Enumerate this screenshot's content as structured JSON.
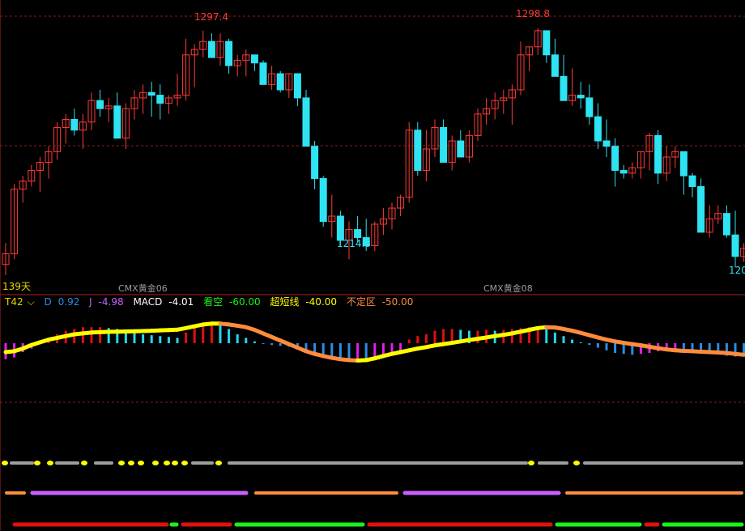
{
  "colors": {
    "background": "#000000",
    "up_candle": "#ff3a3a",
    "down_candle": "#2ee3f2",
    "grid": "#8a1e1e",
    "pane_divider": "#b02020",
    "contract_label": "#9a9a9a",
    "yellow": "#ffff00",
    "orange": "#ff8c3c",
    "red": "#e01010",
    "cyan": "#22d8ee",
    "blue": "#2a8ce8",
    "magenta": "#e020e8",
    "purple": "#c860ff",
    "green": "#19f219",
    "gray": "#9e9e9e",
    "white": "#ffffff",
    "dim": "#b0b0b0"
  },
  "price_labels": {
    "high_1": "1297.4",
    "high_2": "1298.8",
    "low_1": "1214.3",
    "edge_value": "120"
  },
  "bar_count_label": "139天",
  "contract_labels": [
    "CMX黄金06",
    "CMX黄金08"
  ],
  "indicator": {
    "name": "T42",
    "dropdown_glyph": "⌵",
    "d_label": "D",
    "d_value": "0.92",
    "j_label": "J",
    "j_value": "-4.98",
    "macd_label": "MACD",
    "macd_value": "-4.01",
    "bear_label": "看空",
    "bear_value": "-60.00",
    "short_label": "超短线",
    "short_value": "-40.00",
    "neutral_label": "不定区",
    "neutral_value": "-50.00"
  },
  "chart_data": {
    "type": "candlestick",
    "ohlc": [
      [
        1212,
        1220,
        1208,
        1216
      ],
      [
        1216,
        1242,
        1214,
        1240
      ],
      [
        1240,
        1245,
        1235,
        1243
      ],
      [
        1243,
        1249,
        1241,
        1247
      ],
      [
        1247,
        1252,
        1239,
        1250
      ],
      [
        1250,
        1256,
        1244,
        1254
      ],
      [
        1254,
        1265,
        1251,
        1263
      ],
      [
        1263,
        1268,
        1257,
        1266
      ],
      [
        1266,
        1270,
        1260,
        1262
      ],
      [
        1262,
        1268,
        1255,
        1265
      ],
      [
        1265,
        1276,
        1262,
        1273
      ],
      [
        1273,
        1277,
        1267,
        1270
      ],
      [
        1270,
        1274,
        1265,
        1271
      ],
      [
        1271,
        1276,
        1266,
        1259
      ],
      [
        1259,
        1272,
        1255,
        1270
      ],
      [
        1270,
        1277,
        1266,
        1274
      ],
      [
        1274,
        1279,
        1268,
        1276
      ],
      [
        1276,
        1280,
        1267,
        1275
      ],
      [
        1275,
        1279,
        1266,
        1272
      ],
      [
        1272,
        1275,
        1268,
        1274
      ],
      [
        1274,
        1283,
        1271,
        1275
      ],
      [
        1275,
        1296,
        1273,
        1290
      ],
      [
        1290,
        1294,
        1278,
        1292
      ],
      [
        1292,
        1299,
        1289,
        1295
      ],
      [
        1295,
        1298,
        1289,
        1289
      ],
      [
        1289,
        1298,
        1286,
        1295
      ],
      [
        1295,
        1296,
        1283,
        1286
      ],
      [
        1286,
        1290,
        1282,
        1288
      ],
      [
        1288,
        1292,
        1282,
        1290
      ],
      [
        1290,
        1290,
        1284,
        1287
      ],
      [
        1287,
        1288,
        1280,
        1279
      ],
      [
        1279,
        1286,
        1277,
        1283
      ],
      [
        1283,
        1284,
        1276,
        1277
      ],
      [
        1277,
        1283,
        1274,
        1283
      ],
      [
        1283,
        1283,
        1271,
        1274
      ],
      [
        1274,
        1277,
        1258,
        1256
      ],
      [
        1256,
        1258,
        1240,
        1244
      ],
      [
        1244,
        1245,
        1226,
        1228
      ],
      [
        1228,
        1238,
        1222,
        1230
      ],
      [
        1230,
        1232,
        1219,
        1221
      ],
      [
        1221,
        1228,
        1214,
        1225
      ],
      [
        1225,
        1230,
        1220,
        1222
      ],
      [
        1222,
        1229,
        1217,
        1219
      ],
      [
        1219,
        1228,
        1217,
        1227
      ],
      [
        1227,
        1233,
        1223,
        1229
      ],
      [
        1229,
        1235,
        1225,
        1233
      ],
      [
        1233,
        1238,
        1230,
        1237
      ],
      [
        1237,
        1265,
        1235,
        1262
      ],
      [
        1262,
        1265,
        1245,
        1247
      ],
      [
        1247,
        1262,
        1243,
        1255
      ],
      [
        1255,
        1266,
        1252,
        1263
      ],
      [
        1263,
        1266,
        1250,
        1250
      ],
      [
        1250,
        1260,
        1247,
        1258
      ],
      [
        1258,
        1262,
        1252,
        1252
      ],
      [
        1252,
        1262,
        1250,
        1260
      ],
      [
        1260,
        1270,
        1258,
        1268
      ],
      [
        1268,
        1274,
        1264,
        1270
      ],
      [
        1270,
        1276,
        1266,
        1273
      ],
      [
        1273,
        1277,
        1268,
        1274
      ],
      [
        1274,
        1279,
        1264,
        1277
      ],
      [
        1277,
        1295,
        1275,
        1290
      ],
      [
        1290,
        1293,
        1284,
        1293
      ],
      [
        1293,
        1300,
        1290,
        1299
      ],
      [
        1299,
        1299,
        1287,
        1290
      ],
      [
        1290,
        1296,
        1282,
        1282
      ],
      [
        1282,
        1290,
        1273,
        1273
      ],
      [
        1273,
        1285,
        1271,
        1275
      ],
      [
        1275,
        1280,
        1270,
        1274
      ],
      [
        1274,
        1279,
        1264,
        1267
      ],
      [
        1267,
        1272,
        1255,
        1258
      ],
      [
        1258,
        1266,
        1252,
        1256
      ],
      [
        1256,
        1259,
        1241,
        1247
      ],
      [
        1247,
        1249,
        1244,
        1246
      ],
      [
        1246,
        1250,
        1244,
        1248
      ],
      [
        1248,
        1254,
        1244,
        1254
      ],
      [
        1254,
        1261,
        1247,
        1260
      ],
      [
        1260,
        1262,
        1242,
        1246
      ],
      [
        1246,
        1256,
        1243,
        1252
      ],
      [
        1252,
        1256,
        1248,
        1254
      ],
      [
        1254,
        1254,
        1238,
        1245
      ],
      [
        1245,
        1246,
        1237,
        1241
      ],
      [
        1241,
        1244,
        1224,
        1224
      ],
      [
        1224,
        1234,
        1222,
        1229
      ],
      [
        1229,
        1234,
        1227,
        1231
      ],
      [
        1231,
        1234,
        1222,
        1223
      ],
      [
        1223,
        1232,
        1211,
        1215
      ],
      [
        1215,
        1220,
        1213,
        1218
      ]
    ],
    "macd_hist": [
      -0.9,
      -0.8,
      -0.5,
      -0.3,
      0.1,
      0.3,
      0.5,
      0.7,
      0.8,
      0.9,
      0.9,
      0.9,
      0.85,
      0.8,
      0.7,
      0.6,
      0.5,
      0.45,
      0.4,
      0.35,
      0.3,
      0.6,
      1.0,
      1.1,
      1.2,
      1.0,
      0.8,
      0.5,
      0.3,
      0.1,
      -0.05,
      -0.1,
      -0.15,
      -0.2,
      -0.3,
      -0.45,
      -0.65,
      -0.8,
      -0.9,
      -1.0,
      -1.0,
      -0.95,
      -0.95,
      -0.9,
      -0.8,
      -0.7,
      -0.5,
      0.2,
      0.4,
      0.5,
      0.7,
      0.8,
      0.8,
      0.75,
      0.7,
      0.7,
      0.75,
      0.7,
      0.75,
      0.8,
      0.85,
      0.9,
      0.95,
      0.8,
      0.6,
      0.4,
      0.2,
      0.05,
      -0.1,
      -0.25,
      -0.4,
      -0.55,
      -0.6,
      -0.65,
      -0.6,
      -0.55,
      -0.45,
      -0.4,
      -0.35,
      -0.4,
      -0.45,
      -0.55,
      -0.6,
      -0.6,
      -0.7,
      -0.75,
      -0.75
    ],
    "signal_line": [
      -0.5,
      -0.45,
      -0.3,
      -0.1,
      0.05,
      0.2,
      0.3,
      0.4,
      0.5,
      0.55,
      0.6,
      0.62,
      0.64,
      0.65,
      0.66,
      0.67,
      0.68,
      0.7,
      0.72,
      0.74,
      0.76,
      0.85,
      0.95,
      1.05,
      1.1,
      1.1,
      1.05,
      0.98,
      0.9,
      0.75,
      0.55,
      0.35,
      0.15,
      -0.05,
      -0.25,
      -0.45,
      -0.6,
      -0.72,
      -0.82,
      -0.9,
      -0.95,
      -0.97,
      -0.95,
      -0.85,
      -0.72,
      -0.6,
      -0.5,
      -0.4,
      -0.3,
      -0.22,
      -0.12,
      -0.05,
      0.02,
      0.1,
      0.18,
      0.25,
      0.32,
      0.4,
      0.47,
      0.55,
      0.65,
      0.75,
      0.85,
      0.9,
      0.88,
      0.8,
      0.7,
      0.58,
      0.45,
      0.32,
      0.2,
      0.1,
      0.02,
      -0.05,
      -0.12,
      -0.2,
      -0.28,
      -0.35,
      -0.4,
      -0.43,
      -0.45,
      -0.48,
      -0.5,
      -0.52,
      -0.55,
      -0.6,
      -0.65
    ],
    "ylim": [
      1205,
      1305
    ]
  }
}
